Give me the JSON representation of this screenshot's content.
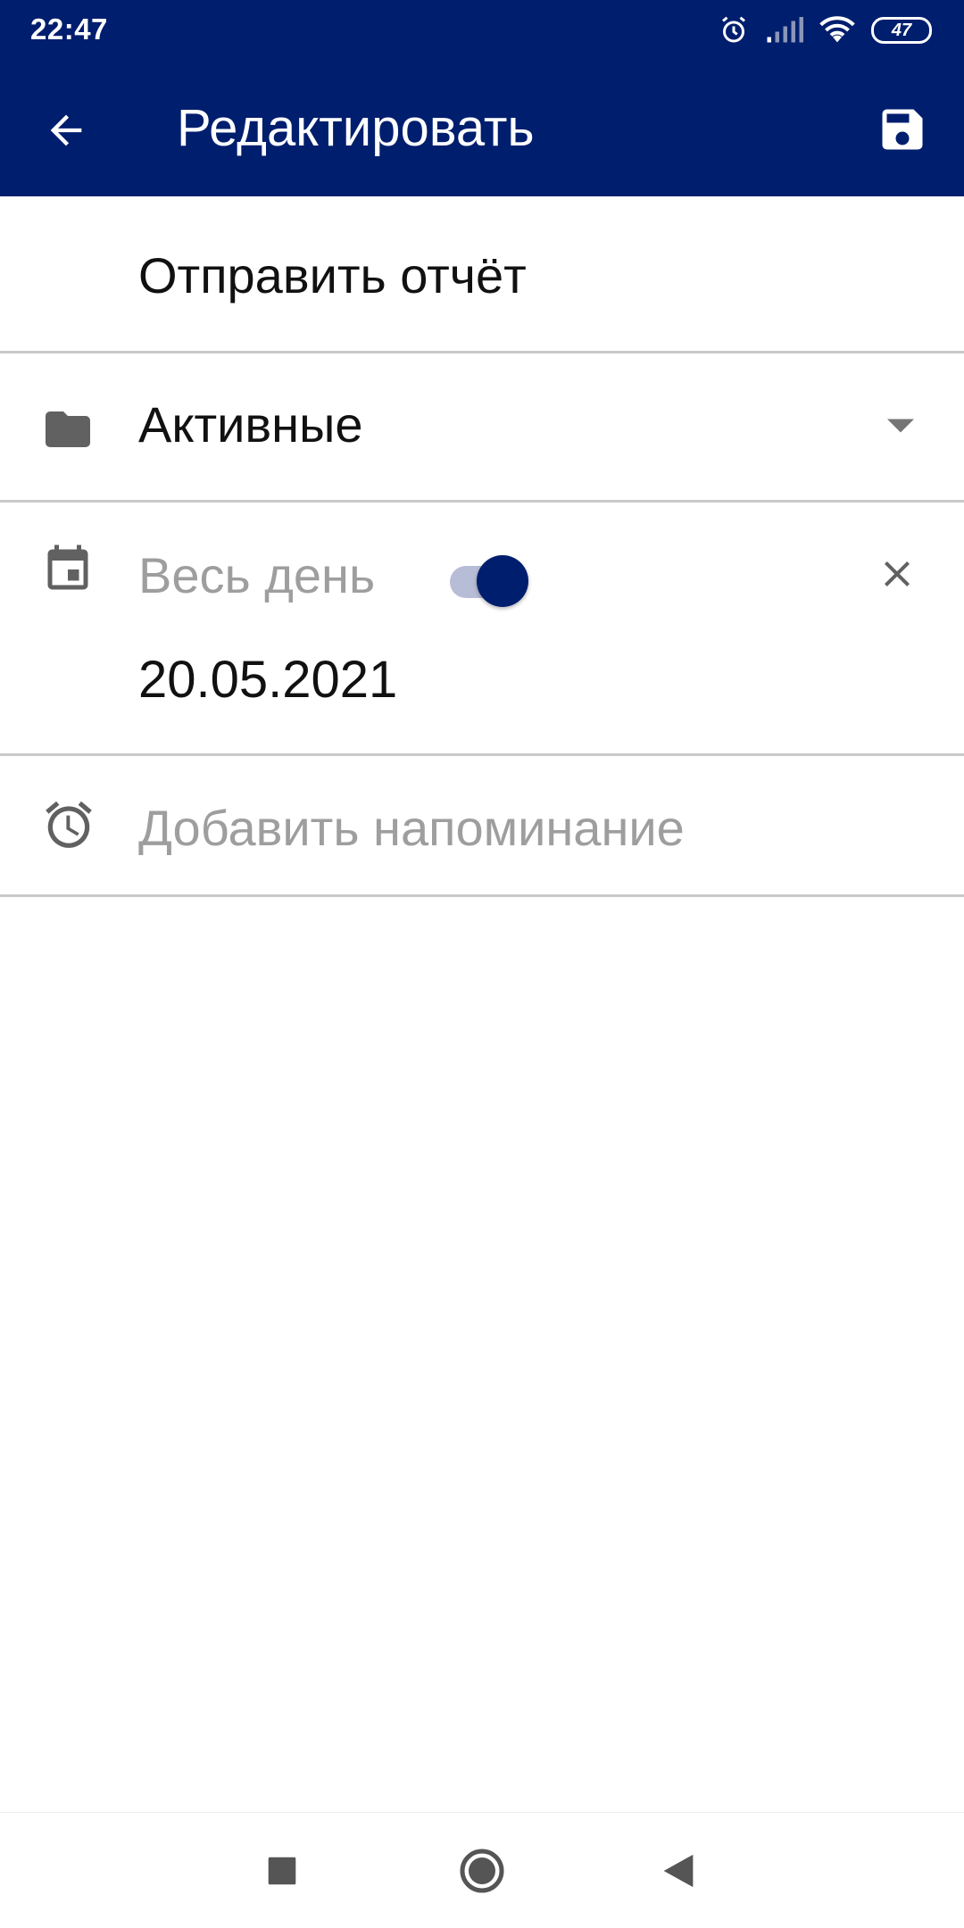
{
  "status_bar": {
    "time": "22:47",
    "battery": "47",
    "icons": [
      "alarm-icon",
      "signal-icon",
      "wifi-icon",
      "battery-icon"
    ]
  },
  "app_bar": {
    "title": "Редактировать",
    "back_icon": "arrow-back-icon",
    "save_icon": "save-icon"
  },
  "form": {
    "task_title": "Отправить отчёт",
    "folder": {
      "icon": "folder-icon",
      "selected": "Активные"
    },
    "date": {
      "icon": "calendar-icon",
      "all_day_label": "Весь день",
      "all_day_on": true,
      "value": "20.05.2021"
    },
    "reminder": {
      "icon": "alarm-icon",
      "placeholder": "Добавить напоминание"
    }
  },
  "nav_bar": {
    "buttons": [
      "recents-square-icon",
      "home-circle-icon",
      "back-triangle-icon"
    ]
  },
  "colors": {
    "primary": "#001e6e",
    "toggle_track": "#b7bdd6",
    "hint_text": "#9e9e9e",
    "divider": "#c9c9c9"
  }
}
